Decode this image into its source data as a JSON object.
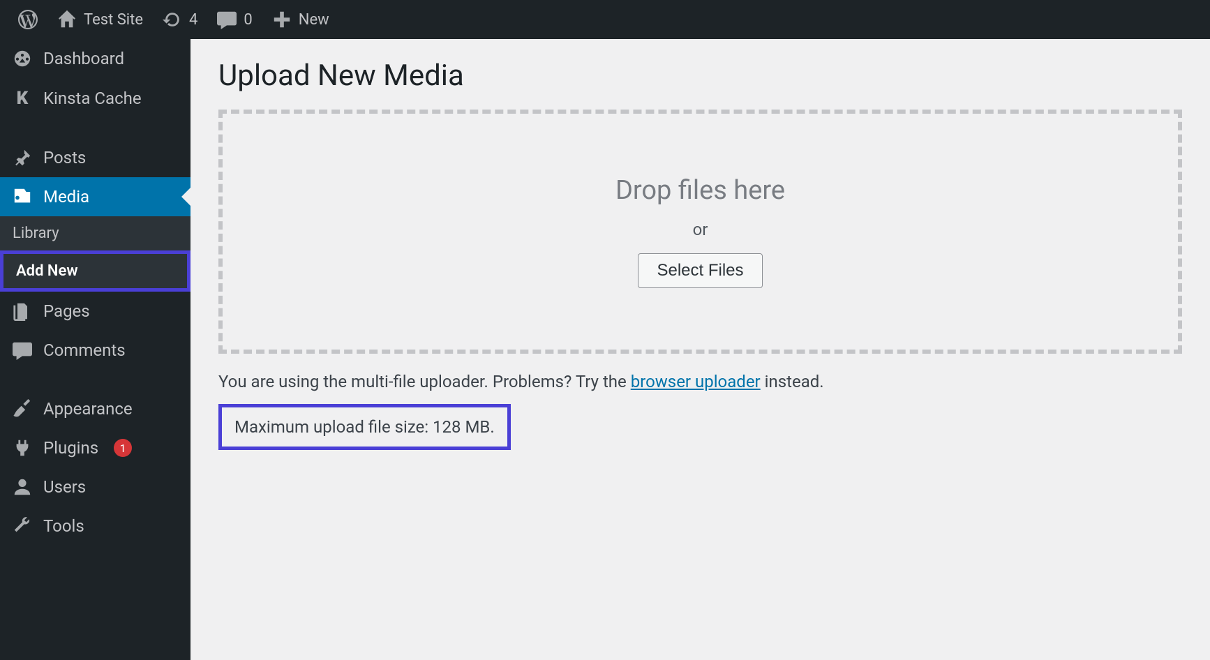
{
  "adminbar": {
    "site_name": "Test Site",
    "updates_count": "4",
    "comments_count": "0",
    "new_label": "New"
  },
  "sidebar": {
    "items": [
      {
        "label": "Dashboard"
      },
      {
        "label": "Kinsta Cache"
      },
      {
        "label": "Posts"
      },
      {
        "label": "Media"
      },
      {
        "label": "Pages"
      },
      {
        "label": "Comments"
      },
      {
        "label": "Appearance"
      },
      {
        "label": "Plugins",
        "badge": "1"
      },
      {
        "label": "Users"
      },
      {
        "label": "Tools"
      }
    ],
    "media_submenu": {
      "library": "Library",
      "add_new": "Add New"
    }
  },
  "main": {
    "title": "Upload New Media",
    "drop_text": "Drop files here",
    "or_text": "or",
    "select_files": "Select Files",
    "hint_prefix": "You are using the multi-file uploader. Problems? Try the ",
    "hint_link": "browser uploader",
    "hint_suffix": " instead.",
    "max_upload": "Maximum upload file size: 128 MB."
  }
}
